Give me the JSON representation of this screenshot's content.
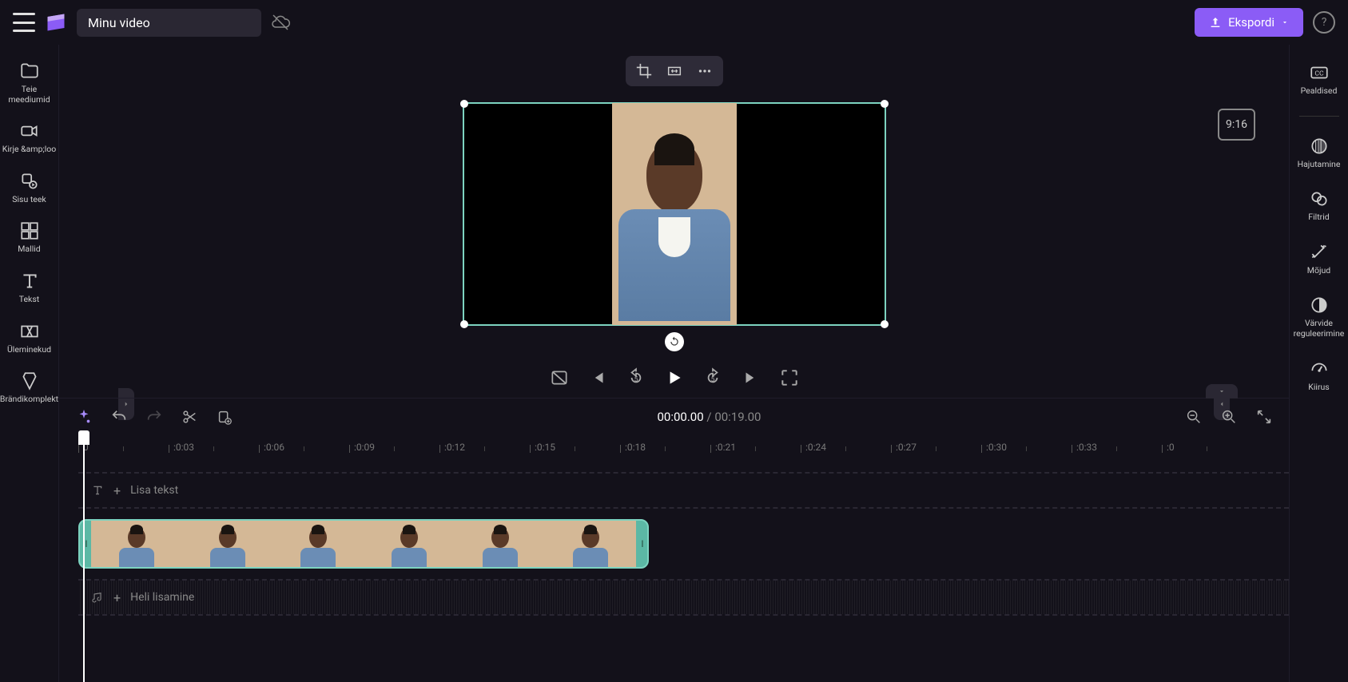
{
  "topbar": {
    "title_value": "Minu video",
    "export_label": "Ekspordi"
  },
  "sidebar_left": {
    "items": [
      {
        "label": "Teie meediumid"
      },
      {
        "label": "Kirje &amp;loo"
      },
      {
        "label": "Sisu teek"
      },
      {
        "label": "Mallid"
      },
      {
        "label": "Tekst"
      },
      {
        "label": "Üleminekud"
      },
      {
        "label": "Brändikomplekt"
      }
    ]
  },
  "sidebar_right": {
    "items": [
      {
        "label": "Pealdised"
      },
      {
        "label": "Hajutamine"
      },
      {
        "label": "Filtrid"
      },
      {
        "label": "Mõjud"
      },
      {
        "label": "Värvide reguleerimine"
      },
      {
        "label": "Kiirus"
      }
    ]
  },
  "preview": {
    "aspect_ratio": "9:16"
  },
  "playback": {
    "current_time": "00:00.00",
    "separator": " / ",
    "total_time": "00:19.00"
  },
  "ruler": {
    "marks": [
      "0",
      ":0:03",
      ":0:06",
      ":0:09",
      ":0:12",
      ":0:15",
      ":0:18",
      ":0:21",
      ":0:24",
      ":0:27",
      ":0:30",
      ":0:33",
      ":0"
    ]
  },
  "tracks": {
    "text_track_label": "Lisa tekst",
    "audio_track_label": "Heli lisamine"
  }
}
